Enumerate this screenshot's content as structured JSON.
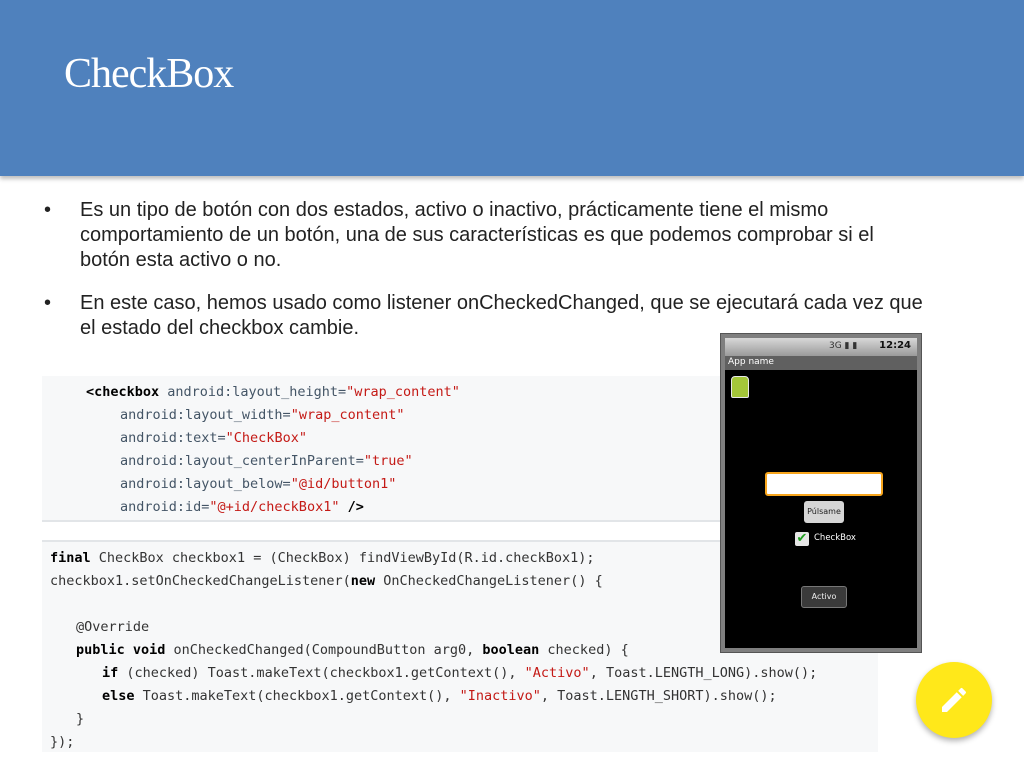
{
  "slide": {
    "title": "CheckBox",
    "bullets": [
      "Es un tipo de botón con dos estados, activo o inactivo, prácticamente tiene el mismo comportamiento de un botón, una de sus características es que podemos comprobar si el botón esta activo o no.",
      "En este caso, hemos usado como listener onCheckedChanged, que se ejecutará cada vez que el estado del checkbox cambie."
    ],
    "bullet_glyph": "•"
  },
  "xml_code": {
    "line1_tag": "<checkbox ",
    "line1_attr": "android:layout_height=",
    "line1_val": "\"wrap_content\"",
    "line2_attr": "android:layout_width=",
    "line2_val": "\"wrap_content\"",
    "line3_attr": "android:text=",
    "line3_val": "\"CheckBox\"",
    "line4_attr": "android:layout_centerInParent=",
    "line4_val": "\"true\"",
    "line5_attr": "android:layout_below=",
    "line5_val": "\"@id/button1\"",
    "line6_attr": "android:id=",
    "line6_val": "\"@+id/checkBox1\"",
    "line6_end": " />"
  },
  "java_code": {
    "l1_kw": "final",
    "l1_rest": " CheckBox checkbox1 = (CheckBox) findViewById(R.id.checkBox1);",
    "l2_a": "checkbox1.setOnCheckedChangeListener(",
    "l2_kw": "new",
    "l2_b": " OnCheckedChangeListener() {",
    "l3": "@Override",
    "l4_kw1": "public void",
    "l4_a": " onCheckedChanged(CompoundButton arg0, ",
    "l4_kw2": "boolean",
    "l4_b": " checked) {",
    "l5_kw": "if",
    "l5_a": " (checked) Toast.makeText(checkbox1.getContext(), ",
    "l5_str": "\"Activo\"",
    "l5_b": ", Toast.LENGTH_LONG).show();",
    "l6_kw": "else",
    "l6_a": " Toast.makeText(checkbox1.getContext(), ",
    "l6_str": "\"Inactivo\"",
    "l6_b": ", Toast.LENGTH_SHORT).show();",
    "l7": "}",
    "l8": "});"
  },
  "phone": {
    "status_icons": "3G ▮ ▮",
    "time": "12:24",
    "app_name": "App name",
    "button_label": "Púlsame",
    "checkbox_label": "CheckBox",
    "checkbox_mark": "✔",
    "toast_text": "Activo"
  },
  "fab": {
    "icon": "pencil-icon",
    "color": "#ffe81a"
  },
  "colors": {
    "header": "#4f81bd",
    "code_string": "#c41a16"
  }
}
